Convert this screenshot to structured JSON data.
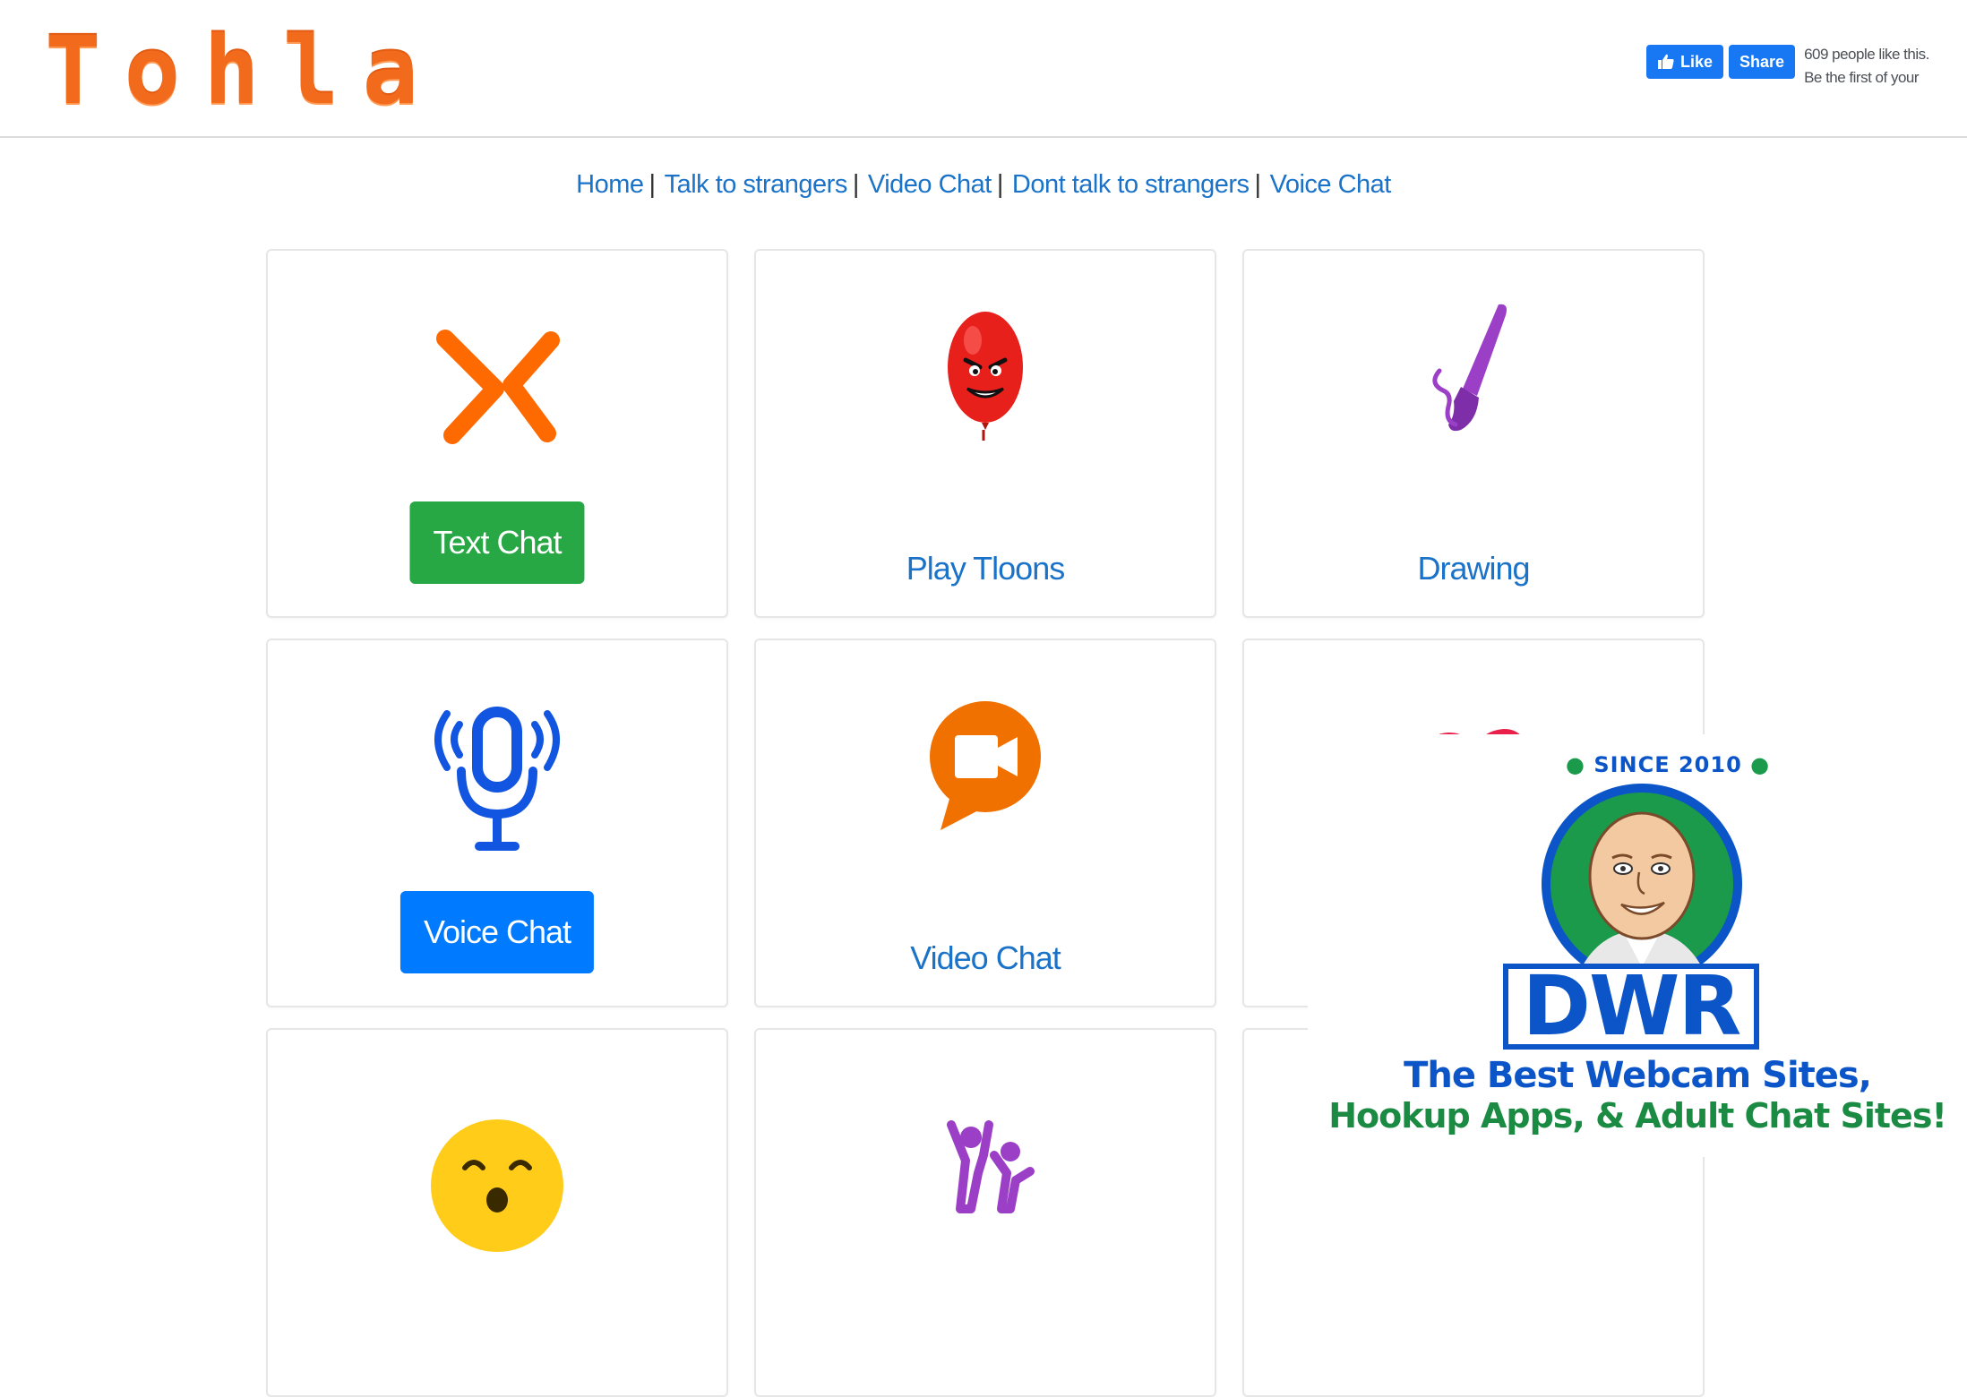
{
  "header": {
    "logo": "Tohla",
    "facebook": {
      "like_label": "Like",
      "share_label": "Share",
      "likes_text_line1": "609 people like this.",
      "likes_text_line2": "Be the first of your"
    }
  },
  "nav": {
    "items": [
      {
        "label": "Home"
      },
      {
        "label": "Talk to strangers"
      },
      {
        "label": "Video Chat"
      },
      {
        "label": "Dont talk to strangers"
      },
      {
        "label": "Voice Chat"
      }
    ],
    "separator": "|"
  },
  "cards": [
    {
      "label": "Text Chat",
      "icon": "x-chat-icon",
      "style": "button-green"
    },
    {
      "label": "Play Tloons",
      "icon": "red-balloon-icon",
      "style": "link"
    },
    {
      "label": "Drawing",
      "icon": "paintbrush-icon",
      "style": "link"
    },
    {
      "label": "Voice Chat",
      "icon": "microphone-icon",
      "style": "button-blue"
    },
    {
      "label": "Video Chat",
      "icon": "video-bubble-icon",
      "style": "link"
    },
    {
      "label": "",
      "icon": "heart-icon",
      "style": "link"
    },
    {
      "label": "",
      "icon": "emoji-face-icon",
      "style": "link"
    },
    {
      "label": "",
      "icon": "people-icon",
      "style": "link"
    },
    {
      "label": "",
      "icon": "",
      "style": "link"
    }
  ],
  "ad": {
    "since": "SINCE 2010",
    "brand": "DWR",
    "line1": "The Best Webcam Sites,",
    "line2": "Hookup Apps, & Adult Chat Sites!"
  },
  "colors": {
    "logo": "#f26b1d",
    "link": "#1a73c8",
    "green_button": "#28a745",
    "blue_button": "#007bff",
    "facebook": "#1877f2",
    "ad_blue": "#0b55c8",
    "ad_green": "#1b8a43"
  }
}
